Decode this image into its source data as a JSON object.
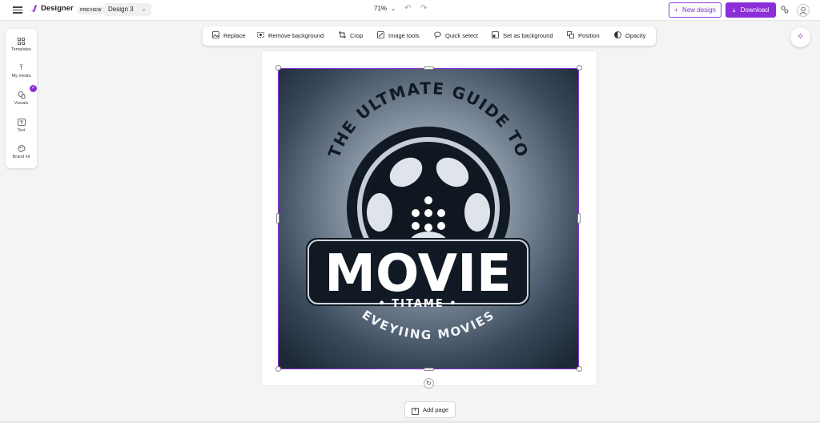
{
  "app": {
    "name": "Designer",
    "badge": "PREVIEW",
    "design_name": "Design 3",
    "zoom": "71%"
  },
  "header": {
    "new_design_label": "New design",
    "download_label": "Download"
  },
  "rail": {
    "items": [
      {
        "label": "Templates",
        "icon": "templates-icon"
      },
      {
        "label": "My media",
        "icon": "upload-icon"
      },
      {
        "label": "Visuals",
        "icon": "shapes-icon"
      },
      {
        "label": "Text",
        "icon": "text-icon"
      },
      {
        "label": "Brand kit",
        "icon": "palette-icon"
      }
    ]
  },
  "toolbar": {
    "items": [
      {
        "label": "Replace",
        "icon": "image-icon"
      },
      {
        "label": "Remove background",
        "icon": "remove-background-icon"
      },
      {
        "label": "Crop",
        "icon": "crop-icon"
      },
      {
        "label": "Image tools",
        "icon": "image-tools-icon"
      },
      {
        "label": "Quick select",
        "icon": "lasso-icon"
      },
      {
        "label": "Set as background",
        "icon": "set-background-icon"
      },
      {
        "label": "Position",
        "icon": "position-icon"
      },
      {
        "label": "Opacity",
        "icon": "opacity-icon"
      }
    ]
  },
  "artwork": {
    "arc_text": "THE ULTMATE GUIDE TO",
    "title": "MOVIE",
    "subtitle": "• TITAME •",
    "bottom_arc_text": "EVEYIING MOVIES"
  },
  "footer": {
    "add_page_label": "Add page"
  },
  "colors": {
    "accent": "#8b2ed8",
    "logo_dark": "#111a24",
    "logo_bg": "#2f3d4e"
  }
}
